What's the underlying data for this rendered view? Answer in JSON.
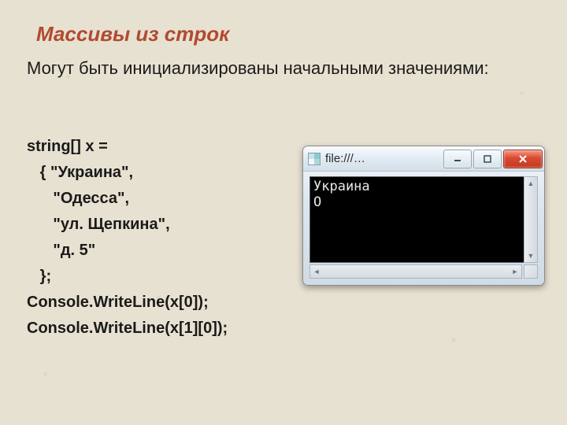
{
  "title": "Массивы из строк",
  "subtitle": "Могут быть инициализированы начальными значениями:",
  "code": {
    "l1": "string[] x =",
    "l2": "   { \"Украина\",",
    "l3": "      \"Одесса\",",
    "l4": "      \"ул. Щепкина\",",
    "l5": "      \"д. 5\"",
    "l6": "   };",
    "l7": "Console.WriteLine(x[0]);",
    "l8": "Console.WriteLine(x[1][0]);"
  },
  "console": {
    "title": "file:///…",
    "output": "Украина\nО"
  }
}
